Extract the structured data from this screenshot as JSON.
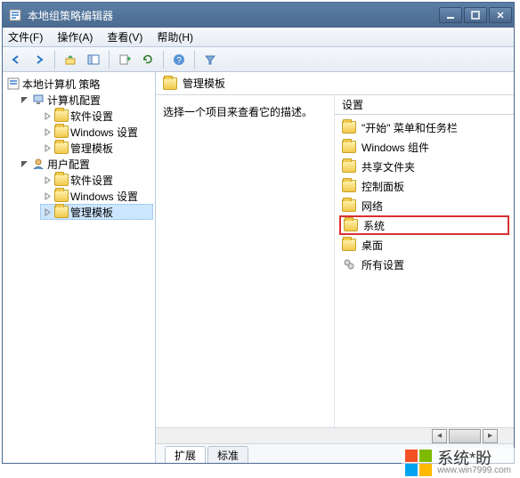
{
  "window": {
    "title": "本地组策略编辑器"
  },
  "menus": {
    "file": "文件(F)",
    "action": "操作(A)",
    "view": "查看(V)",
    "help": "帮助(H)"
  },
  "tree": {
    "root": "本地计算机 策略",
    "computer": "计算机配置",
    "user": "用户配置",
    "software": "软件设置",
    "windows": "Windows 设置",
    "admin": "管理模板"
  },
  "content": {
    "header": "管理模板",
    "description": "选择一个项目来查看它的描述。",
    "settings_col": "设置"
  },
  "settings": [
    {
      "label": "\"开始\" 菜单和任务栏"
    },
    {
      "label": "Windows 组件"
    },
    {
      "label": "共享文件夹"
    },
    {
      "label": "控制面板"
    },
    {
      "label": "网络"
    },
    {
      "label": "系统",
      "highlight": true
    },
    {
      "label": "桌面"
    }
  ],
  "all_settings": "所有设置",
  "tabs": {
    "extended": "扩展",
    "standard": "标准"
  },
  "watermark": {
    "brand": "系统*盼",
    "url": "www.win7999.com"
  }
}
